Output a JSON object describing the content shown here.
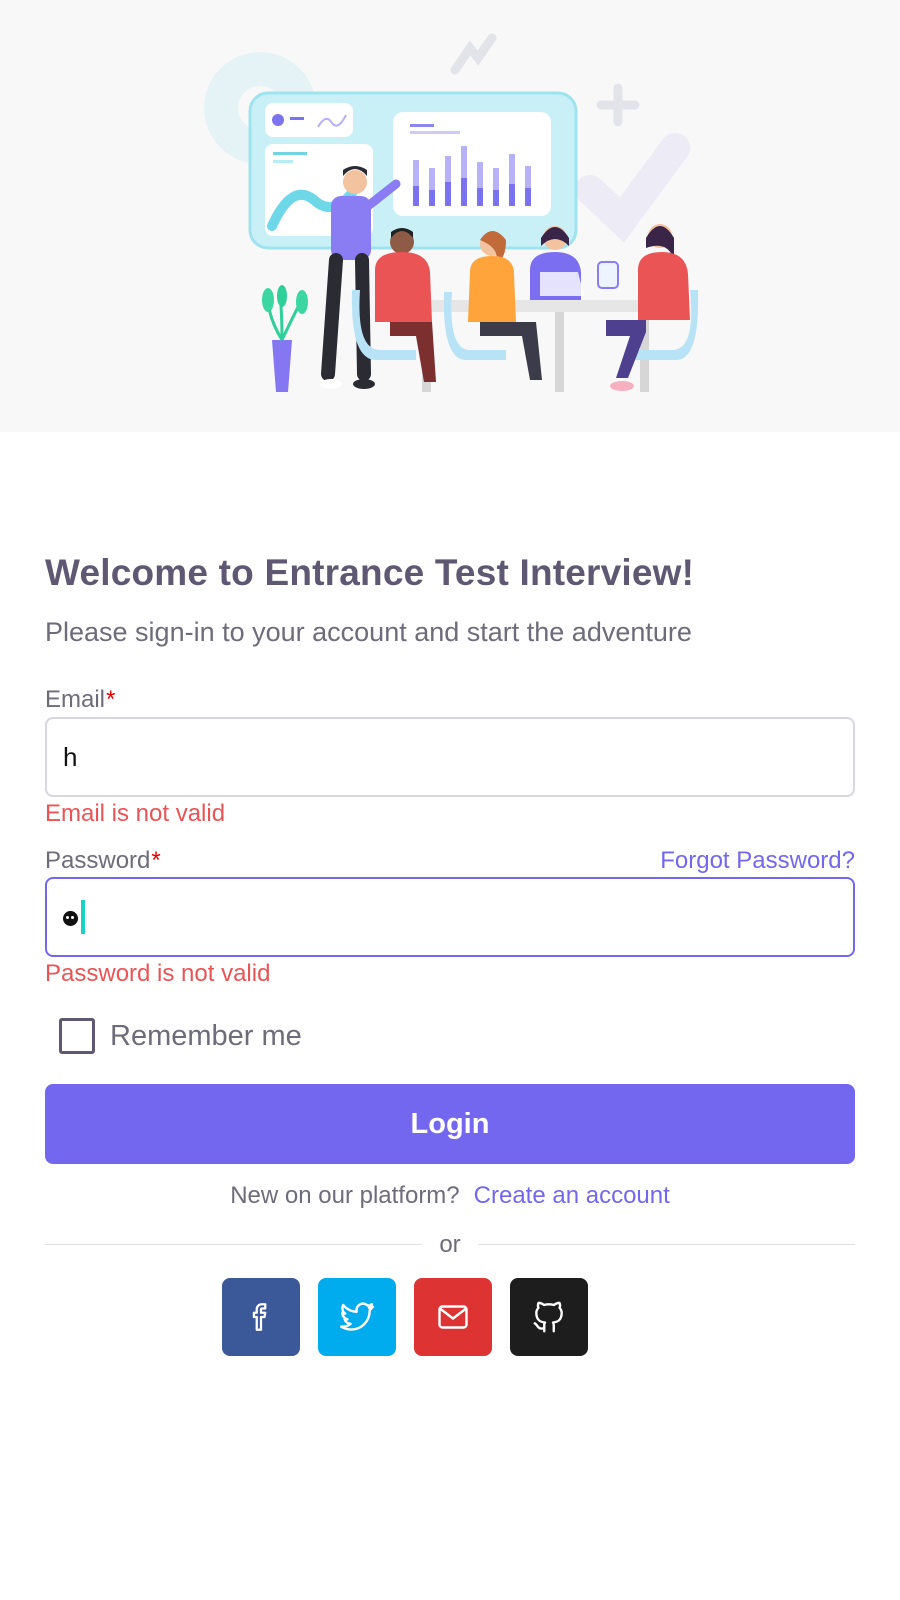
{
  "colors": {
    "primary": "#7367f0",
    "error": "#ea5455",
    "heading": "#5e5873",
    "text": "#6e6b7b",
    "facebook": "#3b5998",
    "twitter": "#00acee",
    "google": "#dd3333",
    "github": "#1d1d1d"
  },
  "header": {
    "title": "Welcome to Entrance Test Interview!",
    "subtitle": "Please sign-in to your account and start the adventure"
  },
  "form": {
    "email_label": "Email",
    "required_mark": "*",
    "email_value": "h",
    "email_error": "Email is not valid",
    "password_label": "Password",
    "forgot_link": "Forgot Password?",
    "password_error": "Password is not valid",
    "remember_label": "Remember me",
    "login_label": "Login"
  },
  "footer": {
    "signup_prompt": "New on our platform?",
    "signup_link": "Create an account",
    "divider_text": "or",
    "social_icons": [
      "facebook-icon",
      "twitter-icon",
      "mail-icon",
      "github-icon"
    ]
  }
}
